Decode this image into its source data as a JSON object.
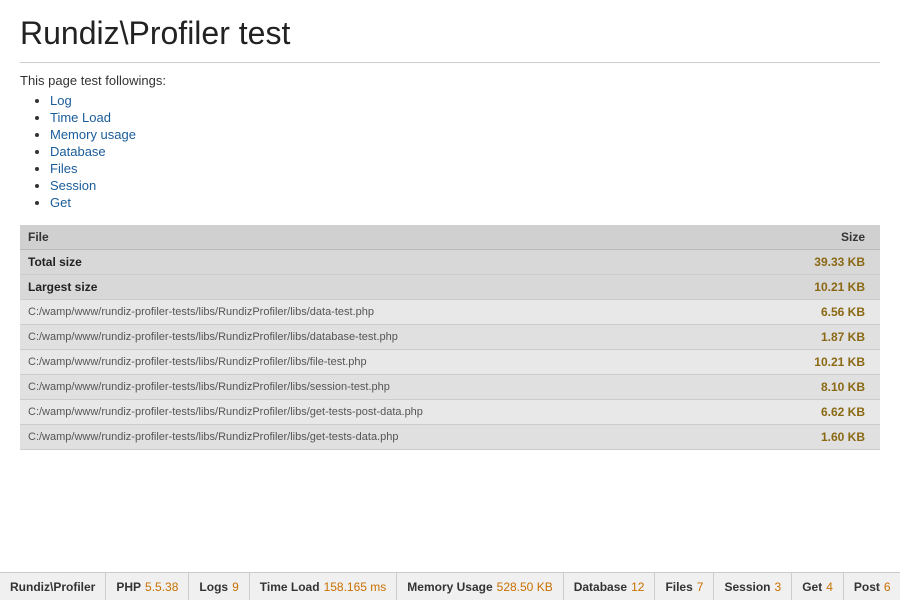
{
  "page": {
    "title": "Rundiz\\Profiler test",
    "intro": "This page test followings:",
    "features": [
      {
        "label": "Log",
        "href": "#"
      },
      {
        "label": "Time Load",
        "href": "#"
      },
      {
        "label": "Memory usage",
        "href": "#"
      },
      {
        "label": "Database",
        "href": "#"
      },
      {
        "label": "Files",
        "href": "#"
      },
      {
        "label": "Session",
        "href": "#"
      },
      {
        "label": "Get",
        "href": "#"
      }
    ]
  },
  "table": {
    "col_file": "File",
    "col_size": "Size",
    "summary_rows": [
      {
        "label": "Total size",
        "value": "39.33 KB"
      },
      {
        "label": "Largest size",
        "value": "10.21 KB"
      }
    ],
    "file_rows": [
      {
        "path": "C:/wamp/www/rundiz-profiler-tests/libs/RundizProfiler/libs/data-test.php",
        "size": "6.56 KB"
      },
      {
        "path": "C:/wamp/www/rundiz-profiler-tests/libs/RundizProfiler/libs/database-test.php",
        "size": "1.87 KB"
      },
      {
        "path": "C:/wamp/www/rundiz-profiler-tests/libs/RundizProfiler/libs/file-test.php",
        "size": "10.21 KB"
      },
      {
        "path": "C:/wamp/www/rundiz-profiler-tests/libs/RundizProfiler/libs/session-test.php",
        "size": "8.10 KB"
      },
      {
        "path": "C:/wamp/www/rundiz-profiler-tests/libs/RundizProfiler/libs/get-tests-post-data.php",
        "size": "6.62 KB"
      },
      {
        "path": "C:/wamp/www/rundiz-profiler-tests/libs/RundizProfiler/libs/get-tests-data.php",
        "size": "1.60 KB"
      }
    ]
  },
  "bottombar": {
    "items": [
      {
        "label": "Rundiz\\Profiler",
        "value": "",
        "id": "rundiz-profiler"
      },
      {
        "label": "PHP",
        "value": "5.5.38",
        "id": "php-version"
      },
      {
        "label": "Logs",
        "value": "9",
        "id": "logs"
      },
      {
        "label": "Time Load",
        "value": "158.165 ms",
        "id": "time-load"
      },
      {
        "label": "Memory Usage",
        "value": "528.50 KB",
        "id": "memory-usage"
      },
      {
        "label": "Database",
        "value": "12",
        "id": "database"
      },
      {
        "label": "Files",
        "value": "7",
        "id": "files"
      },
      {
        "label": "Session",
        "value": "3",
        "id": "session"
      },
      {
        "label": "Get",
        "value": "4",
        "id": "get"
      },
      {
        "label": "Post",
        "value": "6",
        "id": "post"
      }
    ]
  }
}
